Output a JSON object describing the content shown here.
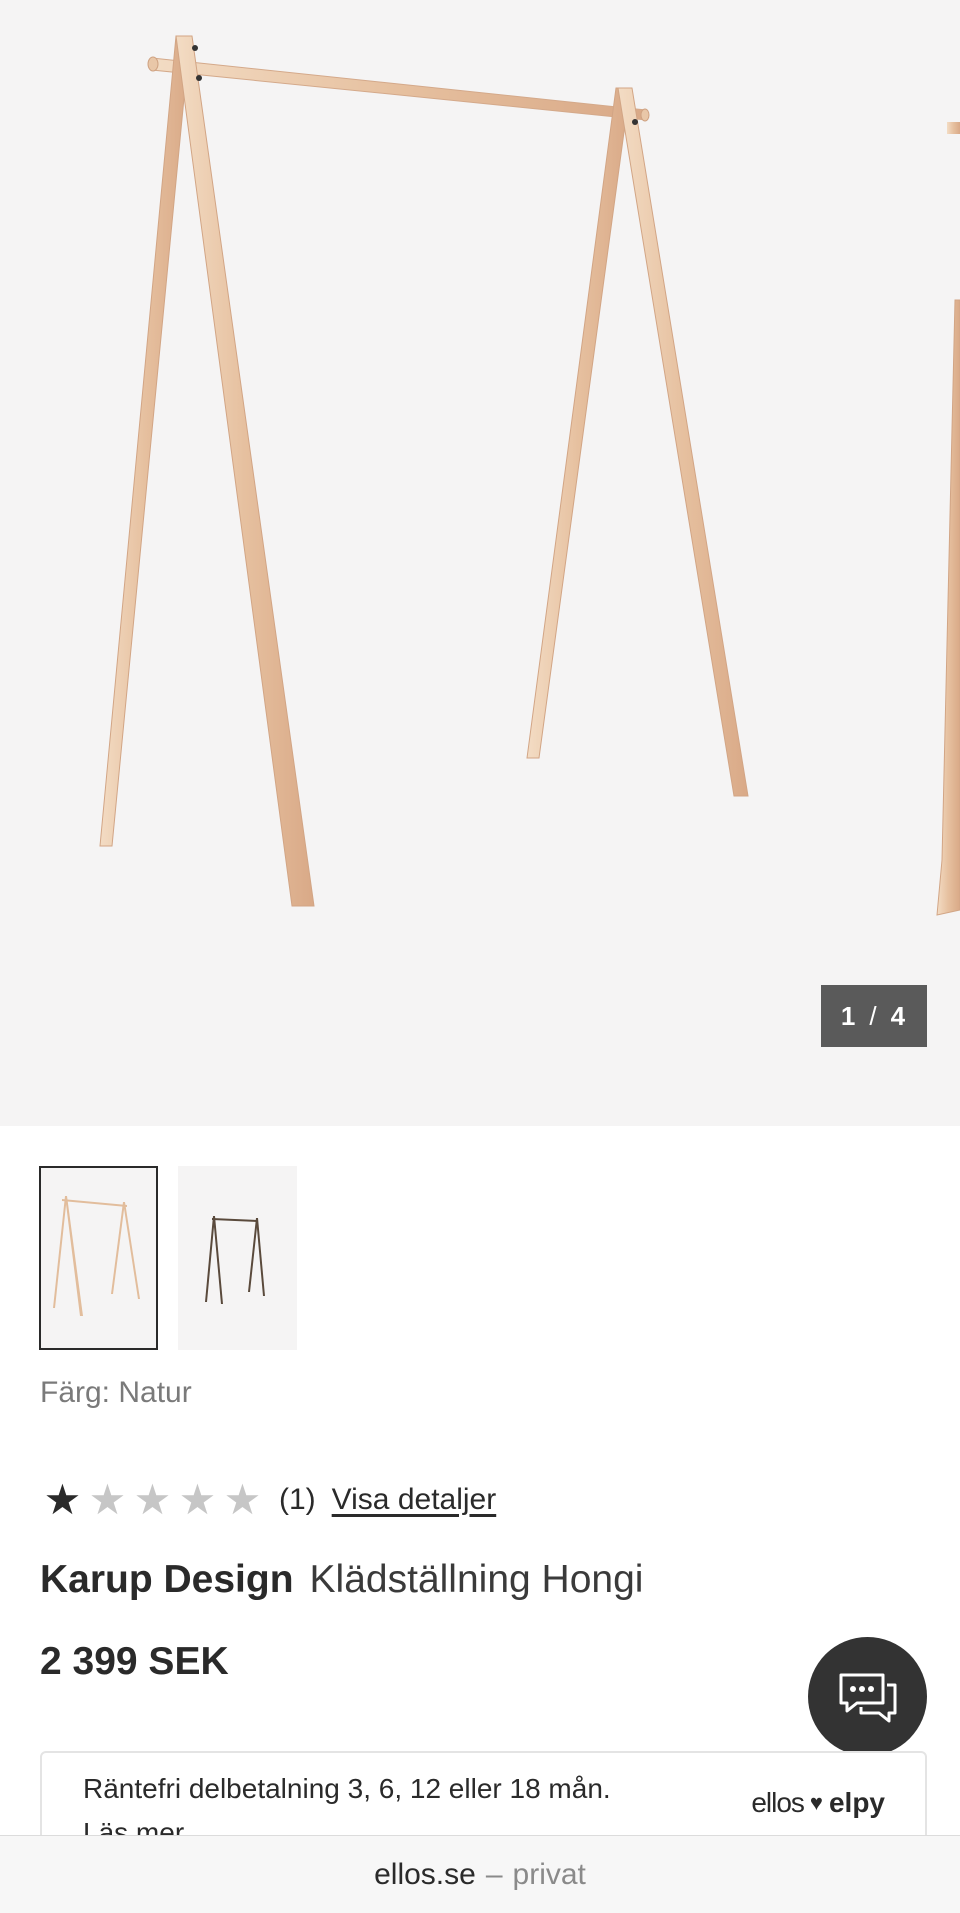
{
  "gallery": {
    "counter_current": "1",
    "counter_separator": "/",
    "counter_total": "4"
  },
  "thumbnails": [
    {
      "variant": "Natur",
      "selected": true
    },
    {
      "variant": "dark",
      "selected": false
    }
  ],
  "product": {
    "color_label": "Färg: Natur",
    "rating_value": 1,
    "rating_max": 5,
    "rating_count": "(1)",
    "rating_link": "Visa detaljer",
    "brand": "Karup Design",
    "name": "Klädställning Hongi",
    "price": "2 399 SEK"
  },
  "payment": {
    "text": "Räntefri delbetalning 3, 6, 12 eller 18 mån.",
    "link": "Läs mer",
    "logo_left": "ellos",
    "logo_right": "elpy"
  },
  "footer": {
    "site": "ellos.se",
    "separator": "–",
    "mode": "privat"
  },
  "colors": {
    "wood": "#e9c7a8",
    "wood_dark": "#d8ad8a",
    "accent_dark": "#2a2a2a",
    "counter_bg": "#5a5a5a",
    "hero_bg": "#f5f4f4"
  }
}
